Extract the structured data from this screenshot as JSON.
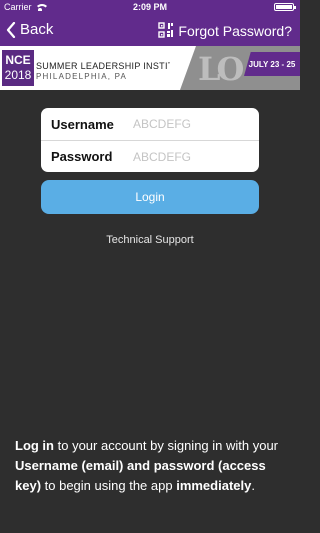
{
  "status_bar": {
    "carrier": "Carrier",
    "time": "2:09 PM"
  },
  "nav": {
    "back_label": "Back",
    "forgot_label": "Forgot Password?",
    "qr_icon": "qr-code-icon"
  },
  "banner": {
    "logo_top": "NCE",
    "logo_year": "2018",
    "title": "SUMMER LEADERSHIP INSTITUTE",
    "location": "PHILADELPHIA, PA",
    "dates": "JULY 23 - 25",
    "art_text": "LO"
  },
  "form": {
    "username_label": "Username",
    "username_placeholder": "ABCDEFG",
    "password_label": "Password",
    "password_placeholder": "ABCDEFG",
    "login_label": "Login",
    "support_label": "Technical Support"
  },
  "info": {
    "part1_bold": "Log in",
    "part2": " to your account by signing in with your ",
    "part3_bold": "Username (email) and password (access key)",
    "part4": " to begin using the app ",
    "part5_bold": "immediately",
    "part6": "."
  },
  "colors": {
    "nav_bg": "#612b8c",
    "login_button": "#5aaee5",
    "background": "#2e2e2e"
  }
}
